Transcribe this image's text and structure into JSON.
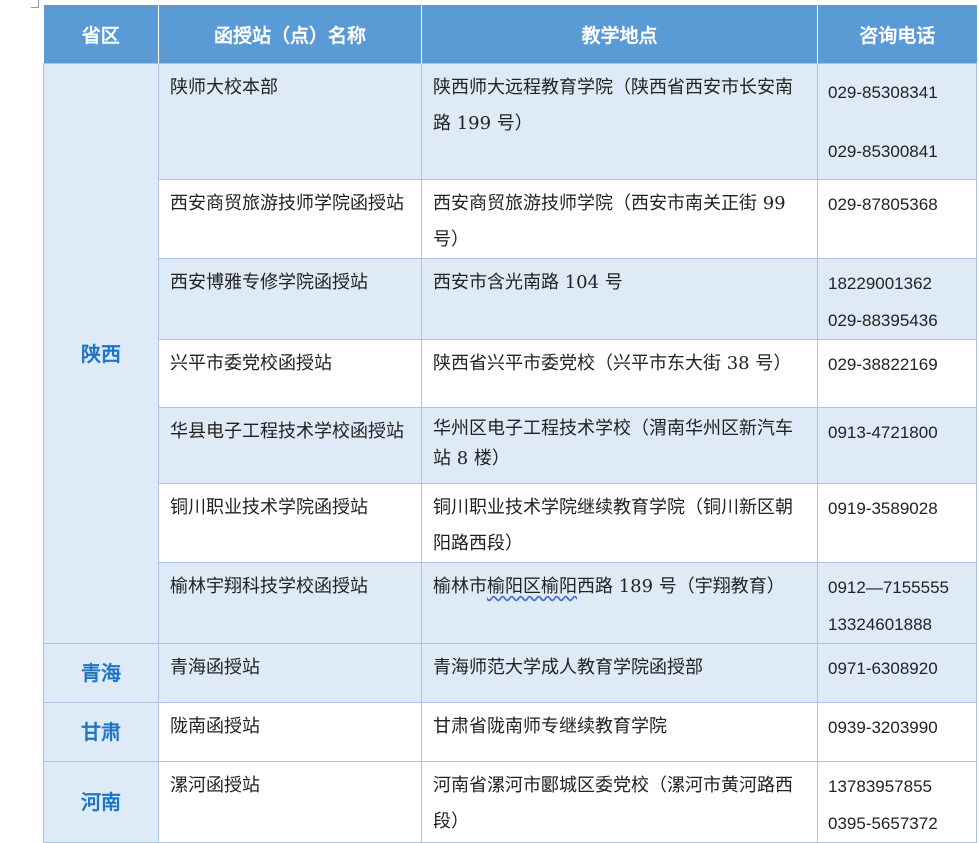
{
  "header": {
    "province": "省区",
    "station": "函授站（点）名称",
    "location": "教学地点",
    "phone": "咨询电话"
  },
  "provinces": {
    "shaanxi": "陕西",
    "qinghai": "青海",
    "gansu": "甘肃",
    "henan": "河南"
  },
  "rows": [
    {
      "station": "陕师大校本部",
      "location": "陕西师大远程教育学院（陕西省西安市长安南路 199 号）",
      "phones": [
        "029-85308341",
        "029-85300841"
      ]
    },
    {
      "station": "西安商贸旅游技师学院函授站",
      "location": "西安商贸旅游技师学院（西安市南关正街 99 号）",
      "phones": [
        "029-87805368"
      ]
    },
    {
      "station": "西安博雅专修学院函授站",
      "location": "西安市含光南路 104 号",
      "phones": [
        "18229001362",
        "029-88395436"
      ]
    },
    {
      "station": "兴平市委党校函授站",
      "location": "陕西省兴平市委党校（兴平市东大街 38 号）",
      "phones": [
        "029-38822169"
      ]
    },
    {
      "station": "华县电子工程技术学校函授站",
      "location": "华州区电子工程技术学校（渭南华州区新汽车站 8 楼）",
      "phones": [
        "0913-4721800"
      ]
    },
    {
      "station": "铜川职业技术学院函授站",
      "location": "铜川职业技术学院继续教育学院（铜川新区朝阳路西段）",
      "phones": [
        "0919-3589028"
      ]
    },
    {
      "station": "榆林宇翔科技学校函授站",
      "location_before": "榆林市",
      "location_marked": "榆阳区榆阳",
      "location_after": "西路 189 号（宇翔教育）",
      "phones": [
        "0912—7155555",
        "13324601888"
      ]
    },
    {
      "station": "青海函授站",
      "location": "青海师范大学成人教育学院函授部",
      "phones": [
        "0971-6308920"
      ]
    },
    {
      "station": "陇南函授站",
      "location": "甘肃省陇南师专继续教育学院",
      "phones": [
        "0939-3203990"
      ]
    },
    {
      "station": "漯河函授站",
      "location": "河南省漯河市郾城区委党校（漯河市黄河路西段）",
      "phones": [
        "13783957855",
        "0395-5657372"
      ]
    }
  ]
}
